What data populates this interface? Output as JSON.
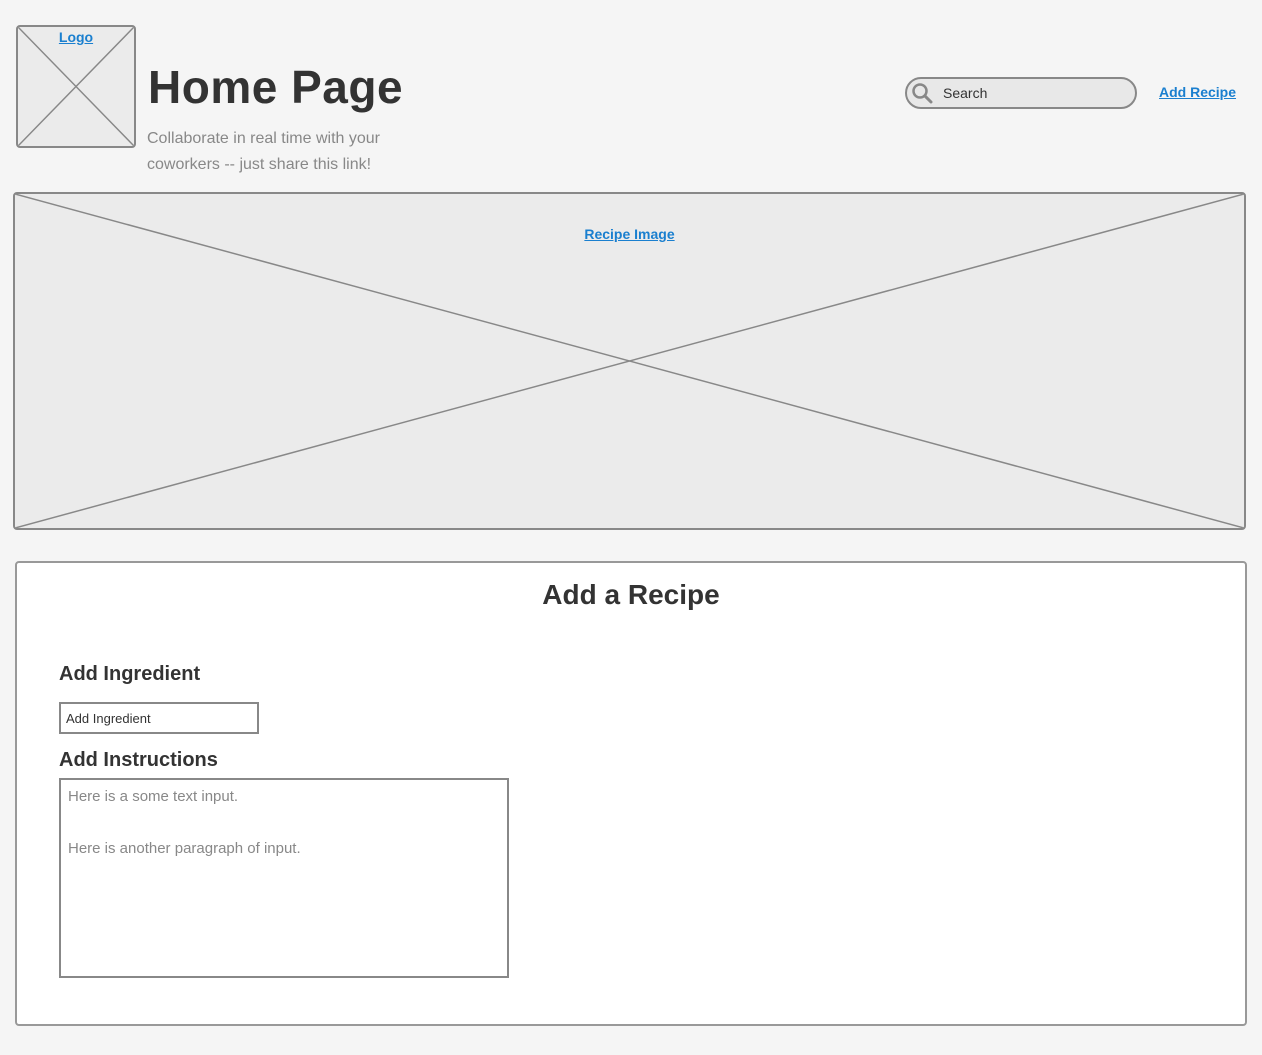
{
  "header": {
    "logo_label": "Logo",
    "title": "Home Page",
    "subtitle": "Collaborate in real time with your coworkers -- just share this link!",
    "search": {
      "placeholder": "Search",
      "icon": "search-icon"
    },
    "add_recipe_link": "Add Recipe"
  },
  "hero": {
    "image_label": "Recipe Image"
  },
  "form": {
    "title": "Add a Recipe",
    "ingredient": {
      "label": "Add Ingredient",
      "placeholder": "Add Ingredient"
    },
    "instructions": {
      "label": "Add Instructions",
      "paragraphs": [
        "Here is a some text input.",
        "Here is another paragraph of input."
      ]
    }
  },
  "colors": {
    "background": "#f5f5f5",
    "link": "#1a7fcf",
    "border": "#888888",
    "placeholder_fill": "#ebebeb",
    "text": "#333333"
  }
}
